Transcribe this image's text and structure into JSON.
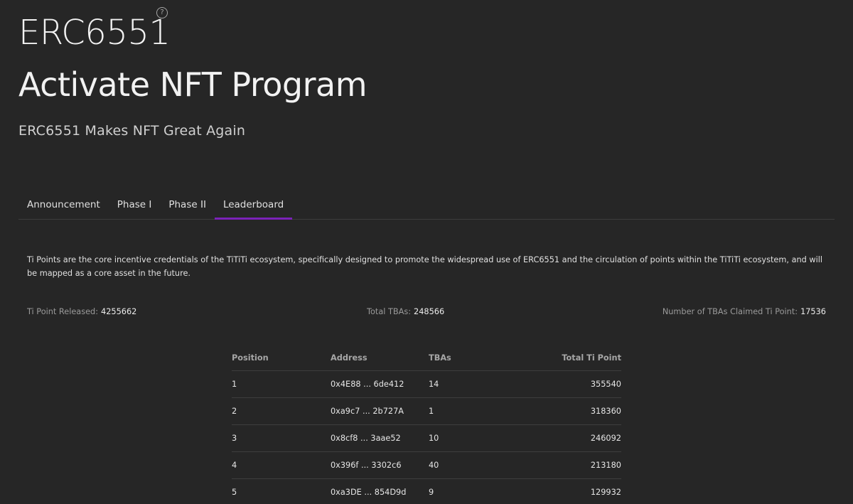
{
  "header": {
    "brand": "ERC6551",
    "help_symbol": "?",
    "program_title": "Activate NFT Program",
    "tagline": "ERC6551 Makes NFT Great Again"
  },
  "tabs": [
    {
      "label": "Announcement",
      "active": false
    },
    {
      "label": "Phase I",
      "active": false
    },
    {
      "label": "Phase II",
      "active": false
    },
    {
      "label": "Leaderboard",
      "active": true
    }
  ],
  "accent_color": "#7b22b8",
  "description": "Ti Points are the core incentive credentials of the TiTiTi ecosystem, specifically designed to promote the widespread use of ERC6551 and the circulation of points within the TiTiTi ecosystem, and will be mapped as a core asset in the future.",
  "stats": {
    "released": {
      "label": "Ti Point Released:",
      "value": "4255662"
    },
    "total_tbas": {
      "label": "Total TBAs:",
      "value": "248566"
    },
    "claimed": {
      "label": "Number of TBAs Claimed Ti Point:",
      "value": "17536"
    }
  },
  "leaderboard": {
    "columns": [
      "Position",
      "Address",
      "TBAs",
      "Total Ti Point"
    ],
    "rows": [
      {
        "position": "1",
        "address": "0x4E88 ... 6de412",
        "tbas": "14",
        "points": "355540"
      },
      {
        "position": "2",
        "address": "0xa9c7 ... 2b727A",
        "tbas": "1",
        "points": "318360"
      },
      {
        "position": "3",
        "address": "0x8cf8 ... 3aae52",
        "tbas": "10",
        "points": "246092"
      },
      {
        "position": "4",
        "address": "0x396f ... 3302c6",
        "tbas": "40",
        "points": "213180"
      },
      {
        "position": "5",
        "address": "0xa3DE ... 854D9d",
        "tbas": "9",
        "points": "129932"
      }
    ]
  }
}
